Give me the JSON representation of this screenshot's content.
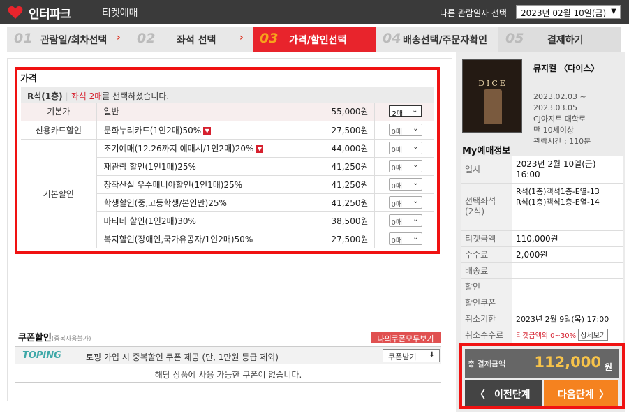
{
  "header": {
    "logo_text": "인터파크",
    "logo_sub": "티켓예매",
    "date_label": "다른 관람일자 선택",
    "date_value": "2023년 02월 10일(금)"
  },
  "steps": [
    {
      "num": "01",
      "label": "관람일/회차선택"
    },
    {
      "num": "02",
      "label": "좌석 선택"
    },
    {
      "num": "03",
      "label": "가격/할인선택"
    },
    {
      "num": "04",
      "label": "배송선택/주문자확인"
    },
    {
      "num": "05",
      "label": "결제하기"
    }
  ],
  "price": {
    "title": "가격",
    "grade": "R석(1층)",
    "selected_prefix": "좌석 2매",
    "selected_suffix": "를 선택하셨습니다.",
    "rows": [
      {
        "category": "기본가",
        "name": "일반",
        "price": "55,000원",
        "qty": "2매"
      },
      {
        "category": "신용카드할인",
        "name": "문화누리카드(1인2매)50%",
        "price": "27,500원",
        "qty": "0매"
      },
      {
        "category": "기본할인",
        "name": "조기예매(12.26까지 예매시/1인2매)20%",
        "price": "44,000원",
        "qty": "0매"
      },
      {
        "name": "재관람 할인(1인1매)25%",
        "price": "41,250원",
        "qty": "0매"
      },
      {
        "name": "창작산실 우수매니아할인(1인1매)25%",
        "price": "41,250원",
        "qty": "0매"
      },
      {
        "name": "학생할인(중,고등학생/본인만)25%",
        "price": "41,250원",
        "qty": "0매"
      },
      {
        "name": "마티네 할인(1인2매)30%",
        "price": "38,500원",
        "qty": "0매"
      },
      {
        "name": "복지할인(장애인,국가유공자/1인2매)50%",
        "price": "27,500원",
        "qty": "0매"
      }
    ]
  },
  "coupon": {
    "title": "쿠폰할인",
    "title_note": "(중복사용불가)",
    "my_coupons": "나의쿠폰모두보기",
    "brand": "TOPING",
    "desc": "토핑 가입 시 중복할인 쿠폰 제공 (단, 1만원 등급 제외)",
    "receive": "쿠폰받기",
    "empty": "해당 상품에 사용 가능한 쿠폰이 없습니다."
  },
  "show": {
    "poster_text": "DICE",
    "title": "뮤지컬 〈다이스〉",
    "period_start": "2023.02.03 ~",
    "period_end": "2023.03.05",
    "venue": "CJ아지트 대학로",
    "age": "만 10세이상",
    "runtime": "관람시간 : 110분"
  },
  "my": {
    "title": "My예매정보",
    "date_label": "일시",
    "date_value": "2023년 2월 10일(금)",
    "time_value": "16:00",
    "seat_label": "선택좌석",
    "seat_count": "(2석)",
    "seat1": "R석(1층)객석1층-E열-13",
    "seat2": "R석(1층)객석1층-E열-14",
    "ticket_label": "티켓금액",
    "ticket_value": "110,000원",
    "fee_label": "수수료",
    "fee_value": "2,000원",
    "delivery_label": "배송료",
    "discount_label": "할인",
    "discount_coupon_label": "할인쿠폰",
    "cancel_deadline_label": "취소기한",
    "cancel_deadline_value": "2023년 2월 9일(목) 17:00",
    "cancel_fee_label": "취소수수료",
    "cancel_fee_value": "티켓금액의 0~30%",
    "detail_btn": "상세보기"
  },
  "total": {
    "label": "총 결제금액",
    "value": "112,000",
    "unit": "원",
    "prev": "이전단계",
    "next": "다음단계"
  }
}
